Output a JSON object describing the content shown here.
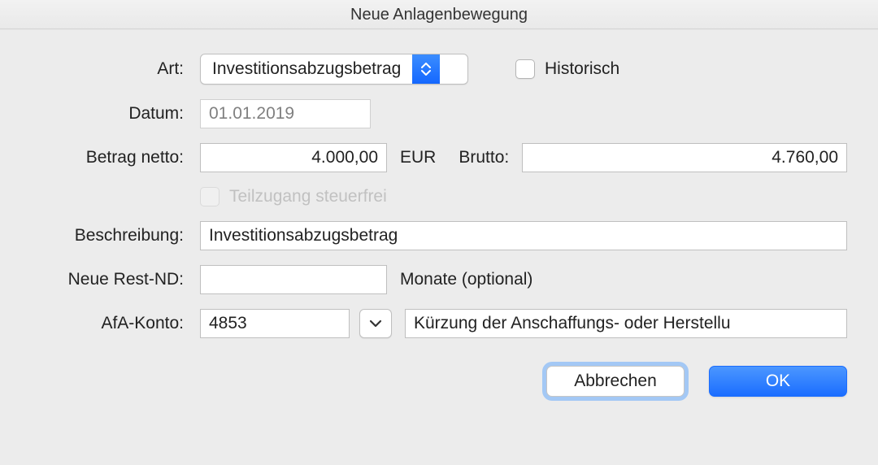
{
  "window": {
    "title": "Neue Anlagenbewegung"
  },
  "labels": {
    "art": "Art:",
    "datum": "Datum:",
    "betragNetto": "Betrag netto:",
    "eur": "EUR",
    "brutto": "Brutto:",
    "teilzugang": "Teilzugang steuerfrei",
    "beschreibung": "Beschreibung:",
    "restNd": "Neue Rest-ND:",
    "monate": "Monate (optional)",
    "afaKonto": "AfA-Konto:",
    "historisch": "Historisch"
  },
  "values": {
    "art": "Investitionsabzugsbetrag",
    "datum": "01.01.2019",
    "netto": "4.000,00",
    "brutto": "4.760,00",
    "beschreibung": "Investitionsabzugsbetrag",
    "restNd": "",
    "afaKonto": "4853",
    "afaKontoText": "Kürzung der Anschaffungs- oder Herstellu"
  },
  "buttons": {
    "cancel": "Abbrechen",
    "ok": "OK"
  }
}
